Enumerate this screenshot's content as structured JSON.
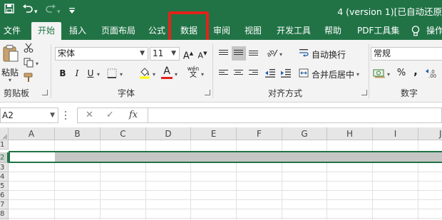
{
  "title_bar": {
    "document_title": "4 (version 1)[已自动还原",
    "quick_access": [
      "save-icon",
      "undo-icon",
      "redo-icon",
      "customize-icon"
    ],
    "background": "#217346"
  },
  "tabs": [
    {
      "label": "文件",
      "active": false
    },
    {
      "label": "开始",
      "active": true
    },
    {
      "label": "插入",
      "active": false
    },
    {
      "label": "页面布局",
      "active": false
    },
    {
      "label": "公式",
      "active": false
    },
    {
      "label": "数据",
      "active": false,
      "highlighted": true
    },
    {
      "label": "审阅",
      "active": false
    },
    {
      "label": "视图",
      "active": false
    },
    {
      "label": "开发工具",
      "active": false
    },
    {
      "label": "帮助",
      "active": false
    },
    {
      "label": "PDF工具集",
      "active": false
    },
    {
      "label": "操作",
      "active": false
    }
  ],
  "highlight_color": "#e2231a",
  "ribbon": {
    "clipboard": {
      "paste_label": "粘贴",
      "group_label": "剪贴板"
    },
    "font": {
      "font_name": "宋体",
      "font_size": "11",
      "bold": "B",
      "italic": "I",
      "underline": "U",
      "grow": "A",
      "shrink": "A",
      "font_color_letter": "A",
      "phonetic_top": "wén",
      "phonetic_bottom": "文",
      "group_label": "字体"
    },
    "alignment": {
      "wrap_text": "自动换行",
      "merge_center": "合并后居中",
      "group_label": "对齐方式"
    },
    "number": {
      "format": "常规",
      "percent": "%",
      "comma": ",",
      "group_label": "数字"
    }
  },
  "formula_bar": {
    "name_box": "A2",
    "cancel_icon": "✕",
    "enter_icon": "✓",
    "fx_label": "fx",
    "value": ""
  },
  "grid": {
    "columns": [
      "A",
      "B",
      "C",
      "D",
      "E",
      "F",
      "G",
      "H",
      "I",
      "J"
    ],
    "rows": [
      "1",
      "2",
      "3",
      "4",
      "5",
      "6",
      "7",
      "8",
      "9"
    ],
    "selected_row": "2",
    "accent": "#217346"
  }
}
